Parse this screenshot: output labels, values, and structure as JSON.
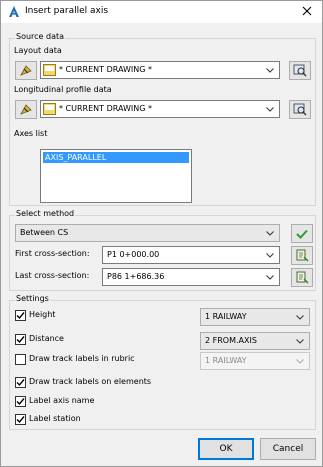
{
  "window": {
    "title": "Insert parallel axis"
  },
  "source_data": {
    "group_label": "Source data",
    "layout_label": "Layout data",
    "layout_value": "* CURRENT DRAWING *",
    "profile_label": "Longitudinal profile data",
    "profile_value": "* CURRENT DRAWING *",
    "axes_list_label": "Axes list",
    "axes": [
      "AXIS_PARALLEL"
    ]
  },
  "select_method": {
    "group_label": "Select method",
    "method_value": "Between CS",
    "first_label": "First cross-section:",
    "first_value": "P1 0+000.00",
    "last_label": "Last cross-section:",
    "last_value": "P86 1+686.36"
  },
  "settings": {
    "group_label": "Settings",
    "height_label": "Height",
    "height_checked": true,
    "height_value": "1 RAILWAY",
    "distance_label": "Distance",
    "distance_checked": true,
    "distance_value": "2 FROM.AXIS",
    "rubric_label": "Draw track labels in rubric",
    "rubric_checked": false,
    "rubric_value": "1 RAILWAY",
    "elements_label": "Draw track labels on elements",
    "elements_checked": true,
    "axis_name_label": "Label axis name",
    "axis_name_checked": true,
    "station_label": "Label station",
    "station_checked": true
  },
  "buttons": {
    "ok": "OK",
    "cancel": "Cancel"
  },
  "colors": {
    "selection": "#3399ff",
    "confirm_green": "#2e9e2e",
    "default_button_border": "#0078d7"
  }
}
